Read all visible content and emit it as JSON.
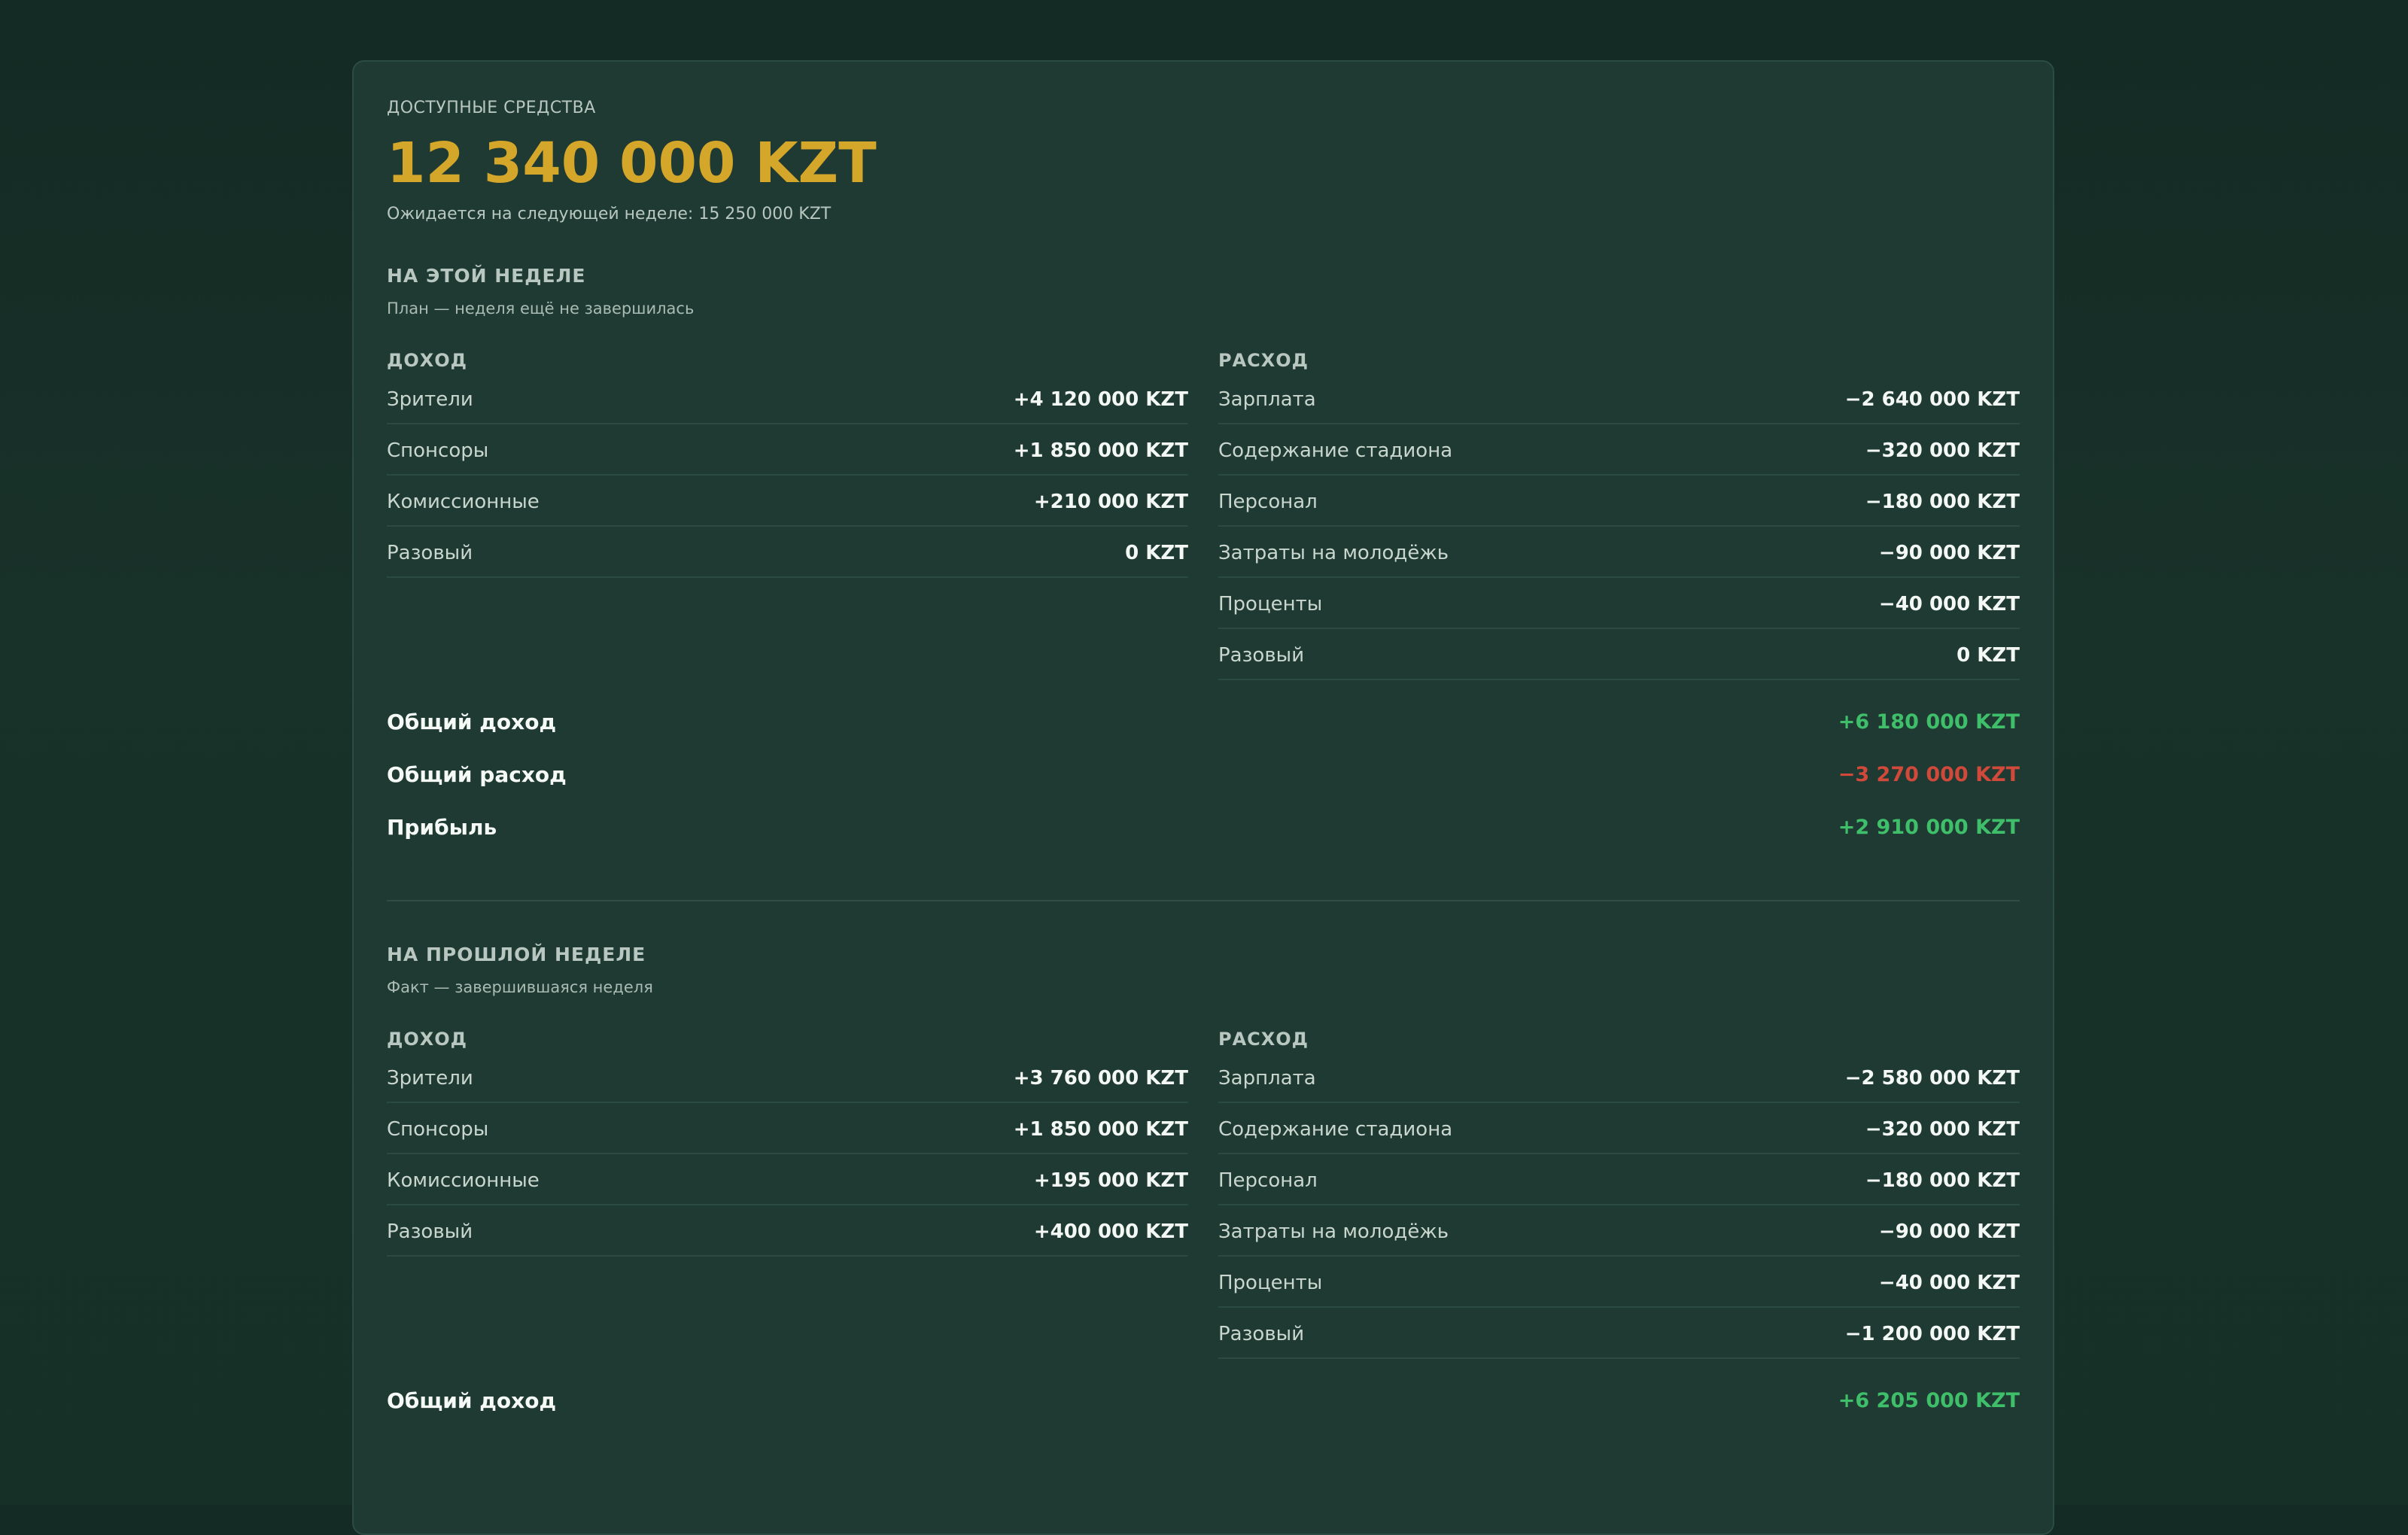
{
  "balance": {
    "label": "ДОСТУПНЫЕ СРЕДСТВА",
    "amount": "12 340 000 KZT",
    "expected": "Ожидается на следующей неделе: 15 250 000 KZT"
  },
  "colors": {
    "accent_gold": "#d4a62a",
    "positive": "#3fbf6a",
    "negative": "#d0493a"
  },
  "this_week": {
    "title": "НА ЭТОЙ НЕДЕЛЕ",
    "subtitle": "План — неделя ещё не завершилась",
    "income_title": "ДОХОД",
    "expense_title": "РАСХОД",
    "income": [
      {
        "name": "Зрители",
        "value": "+4 120 000 KZT"
      },
      {
        "name": "Спонсоры",
        "value": "+1 850 000 KZT"
      },
      {
        "name": "Комиссионные",
        "value": "+210 000 KZT"
      },
      {
        "name": "Разовый",
        "value": "0 KZT"
      }
    ],
    "expense": [
      {
        "name": "Зарплата",
        "value": "−2 640 000 KZT"
      },
      {
        "name": "Содержание стадиона",
        "value": "−320 000 KZT"
      },
      {
        "name": "Персонал",
        "value": "−180 000 KZT"
      },
      {
        "name": "Затраты на молодёжь",
        "value": "−90 000 KZT"
      },
      {
        "name": "Проценты",
        "value": "−40 000 KZT"
      },
      {
        "name": "Разовый",
        "value": "0 KZT"
      }
    ],
    "totals": {
      "income_label": "Общий доход",
      "income_value": "+6 180 000 KZT",
      "expense_label": "Общий расход",
      "expense_value": "−3 270 000 KZT",
      "profit_label": "Прибыль",
      "profit_value": "+2 910 000 KZT"
    }
  },
  "last_week": {
    "title": "НА ПРОШЛОЙ НЕДЕЛЕ",
    "subtitle": "Факт — завершившаяся неделя",
    "income_title": "ДОХОД",
    "expense_title": "РАСХОД",
    "income": [
      {
        "name": "Зрители",
        "value": "+3 760 000 KZT"
      },
      {
        "name": "Спонсоры",
        "value": "+1 850 000 KZT"
      },
      {
        "name": "Комиссионные",
        "value": "+195 000 KZT"
      },
      {
        "name": "Разовый",
        "value": "+400 000 KZT"
      }
    ],
    "expense": [
      {
        "name": "Зарплата",
        "value": "−2 580 000 KZT"
      },
      {
        "name": "Содержание стадиона",
        "value": "−320 000 KZT"
      },
      {
        "name": "Персонал",
        "value": "−180 000 KZT"
      },
      {
        "name": "Затраты на молодёжь",
        "value": "−90 000 KZT"
      },
      {
        "name": "Проценты",
        "value": "−40 000 KZT"
      },
      {
        "name": "Разовый",
        "value": "−1 200 000 KZT"
      }
    ],
    "totals": {
      "income_label": "Общий доход",
      "income_value": "+6 205 000 KZT"
    }
  }
}
